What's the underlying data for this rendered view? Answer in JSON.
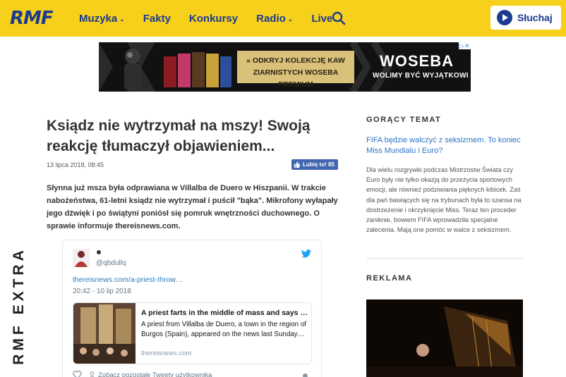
{
  "header": {
    "logo": "RMF",
    "nav": [
      {
        "label": "Muzyka",
        "has_dropdown": true
      },
      {
        "label": "Fakty",
        "has_dropdown": false
      },
      {
        "label": "Konkursy",
        "has_dropdown": false
      },
      {
        "label": "Radio",
        "has_dropdown": true
      },
      {
        "label": "Live",
        "has_dropdown": false
      }
    ],
    "search_icon": "search-icon",
    "listen_label": "Słuchaj",
    "colors": {
      "bar": "#f7d01c",
      "brand": "#1b3b8f"
    }
  },
  "top_ad": {
    "cta_line1": "» ODKRYJ KOLEKCJĘ KAW",
    "cta_line2": "ZIARNISTYCH WOSEBA PREMIUM",
    "brand": "WOSEBA",
    "tagline": "WOLIMY BYĆ WYJĄTKOWI"
  },
  "side_brand": "RMF EXTRA",
  "article": {
    "headline": "Ksiądz nie wytrzymał na mszy! Swoją reakcję tłumaczył objawieniem...",
    "date": "13 lipca 2018, 08:45",
    "fb_like": "Lubię to! 85",
    "lead": "Słynna już msza była odprawiana w Villalba de Duero w Hiszpanii. W trakcie nabożeństwa, 61-letni ksiądz nie wytrzymał i puścił \"bąka\". Mikrofony wyłapały jego dźwięk i po świątyni poniósł się pomruk wnętrzności duchownego. O sprawie informuje thereisnews.com."
  },
  "tweet": {
    "handle": "@qbdullq",
    "link": "thereisnews.com/a-priest-throw…",
    "time": "20:42 - 10 lip 2018",
    "card_title": "A priest farts in the middle of mass and says …",
    "card_desc": "A priest from Villalba de Duero, a town in the region of Burgos (Spain), appeared on the news last Sunday…",
    "card_domain": "thereisnews.com",
    "footer": "Zobacz pozostałe Tweety użytkownika"
  },
  "sidebar": {
    "hot_title": "GORĄCY TEMAT",
    "hot_link": "FIFA będzie walczyć z seksizmem. To koniec Miss Mundialu i Euro?",
    "hot_text": "Dla wielu rozgrywki podczas Mistrzostw Świata czy Euro były nie tylko okazją do przeżycia sportowych emocji, ale również podziwiania pięknych kibicek. Zaś dla pań bawiących się na trybunach była to szansa na dostrzeżenie i okrzyknięcie Miss. Teraz ten proceder zaniknie, bowiem FIFA wprowadziła specjalne zalecenia. Mają one pomóc w walce z seksizmem.",
    "ad_title": "REKLAMA"
  }
}
